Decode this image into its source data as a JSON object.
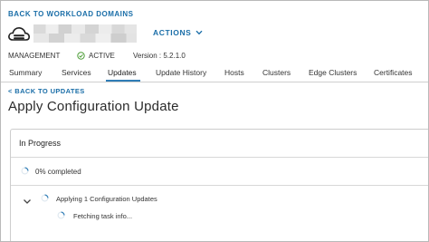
{
  "header": {
    "back_link": "BACK TO WORKLOAD DOMAINS",
    "actions_label": "ACTIONS",
    "domain_type": "MANAGEMENT",
    "status": "ACTIVE",
    "version": "Version : 5.2.1.0"
  },
  "tabs": [
    {
      "label": "Summary",
      "active": false
    },
    {
      "label": "Services",
      "active": false
    },
    {
      "label": "Updates",
      "active": true
    },
    {
      "label": "Update History",
      "active": false
    },
    {
      "label": "Hosts",
      "active": false
    },
    {
      "label": "Clusters",
      "active": false
    },
    {
      "label": "Edge Clusters",
      "active": false
    },
    {
      "label": "Certificates",
      "active": false
    }
  ],
  "page": {
    "back_link": "< BACK TO UPDATES",
    "title": "Apply Configuration Update"
  },
  "card": {
    "title": "In Progress",
    "progress_text": "0% completed",
    "progress_value": 0,
    "task_label": "Applying 1 Configuration Updates",
    "subtask_label": "Fetching task info..."
  },
  "colors": {
    "link": "#1a6ea8",
    "tab_active_underline": "#2f7db6",
    "status_ok": "#4f9f3a",
    "spinner": "#2f7db6"
  },
  "icons": {
    "domain": "cloud-icon",
    "actions": "chevron-down-icon",
    "status": "check-circle-icon",
    "progress": "spinner-icon",
    "expand": "chevron-down-icon"
  }
}
